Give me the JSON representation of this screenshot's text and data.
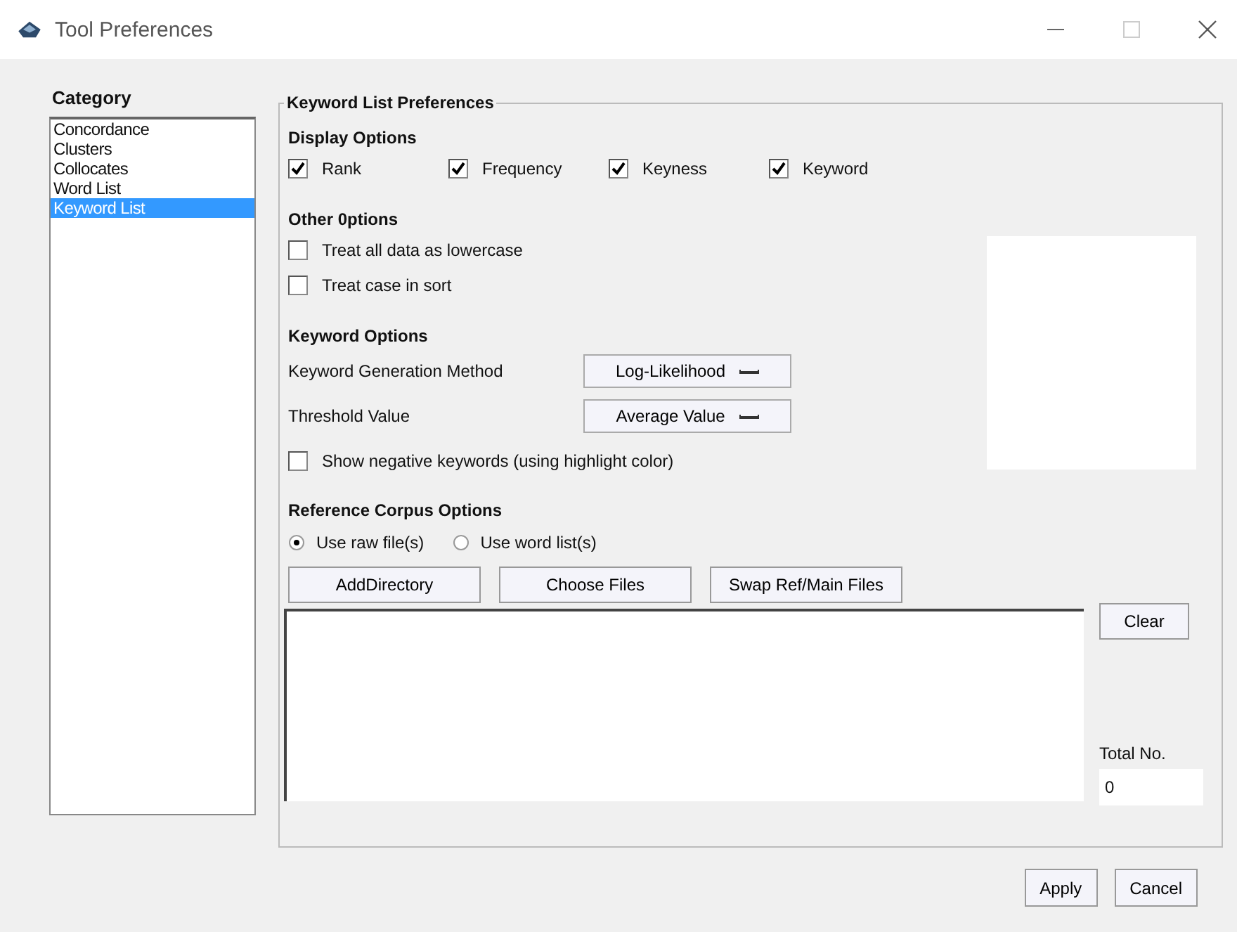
{
  "window": {
    "title": "Tool Preferences"
  },
  "category": {
    "label": "Category",
    "items": [
      {
        "label": "Concordance",
        "selected": false
      },
      {
        "label": "Clusters",
        "selected": false
      },
      {
        "label": "Collocates",
        "selected": false
      },
      {
        "label": "Word List",
        "selected": false
      },
      {
        "label": "Keyword List",
        "selected": true
      }
    ]
  },
  "preferences": {
    "title": "Keyword List Preferences",
    "display_options": {
      "heading": "Display Options",
      "items": [
        {
          "label": "Rank",
          "checked": true
        },
        {
          "label": "Frequency",
          "checked": true
        },
        {
          "label": "Keyness",
          "checked": true
        },
        {
          "label": "Keyword",
          "checked": true
        }
      ]
    },
    "other_options": {
      "heading": "Other 0ptions",
      "items": [
        {
          "label": "Treat all data as lowercase",
          "checked": false
        },
        {
          "label": "Treat case in sort",
          "checked": false
        }
      ]
    },
    "keyword_options": {
      "heading": "Keyword Options",
      "fields": [
        {
          "label": "Keyword Generation Method",
          "value": "Log-Likelihood"
        },
        {
          "label": "Threshold Value",
          "value": "Average Value"
        }
      ],
      "negative": {
        "label": "Show negative keywords (using highlight color)",
        "checked": false
      }
    },
    "reference_corpus": {
      "heading": "Reference Corpus Options",
      "options": [
        {
          "label": "Use raw file(s)",
          "selected": true
        },
        {
          "label": "Use word list(s)",
          "selected": false
        }
      ],
      "buttons": [
        "AddDirectory",
        "Choose Files",
        "Swap Ref/Main Files"
      ],
      "clear_button": "Clear",
      "total_label": "Total No.",
      "total_value": "0"
    }
  },
  "buttons": [
    "Apply",
    "Cancel"
  ]
}
